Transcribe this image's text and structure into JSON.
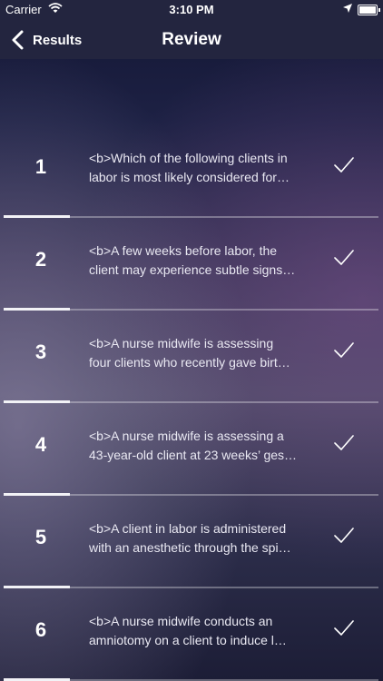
{
  "status_bar": {
    "carrier": "Carrier",
    "time": "3:10 PM",
    "icons": [
      "wifi-icon",
      "location-arrow-icon",
      "battery-icon"
    ]
  },
  "nav": {
    "back_label": "Results",
    "title": "Review"
  },
  "questions": [
    {
      "number": "1",
      "line1": "<b>Which of the following clients in",
      "line2": "labor is most likely considered for…",
      "icon": "checkmark-icon"
    },
    {
      "number": "2",
      "line1": "<b>A few weeks before labor, the",
      "line2": "client may experience subtle signs…",
      "icon": "checkmark-icon"
    },
    {
      "number": "3",
      "line1": "<b>A nurse midwife is assessing",
      "line2": "four clients who recently gave birt…",
      "icon": "checkmark-icon"
    },
    {
      "number": "4",
      "line1": "<b>A nurse midwife is assessing a",
      "line2": "43-year-old client at 23 weeks’ ges…",
      "icon": "checkmark-icon"
    },
    {
      "number": "5",
      "line1": "<b>A client in labor is administered",
      "line2": "with an anesthetic through the spi…",
      "icon": "checkmark-icon"
    },
    {
      "number": "6",
      "line1": "<b>A nurse midwife conducts an",
      "line2": "amniotomy on a client to induce l…",
      "icon": "checkmark-icon"
    }
  ]
}
